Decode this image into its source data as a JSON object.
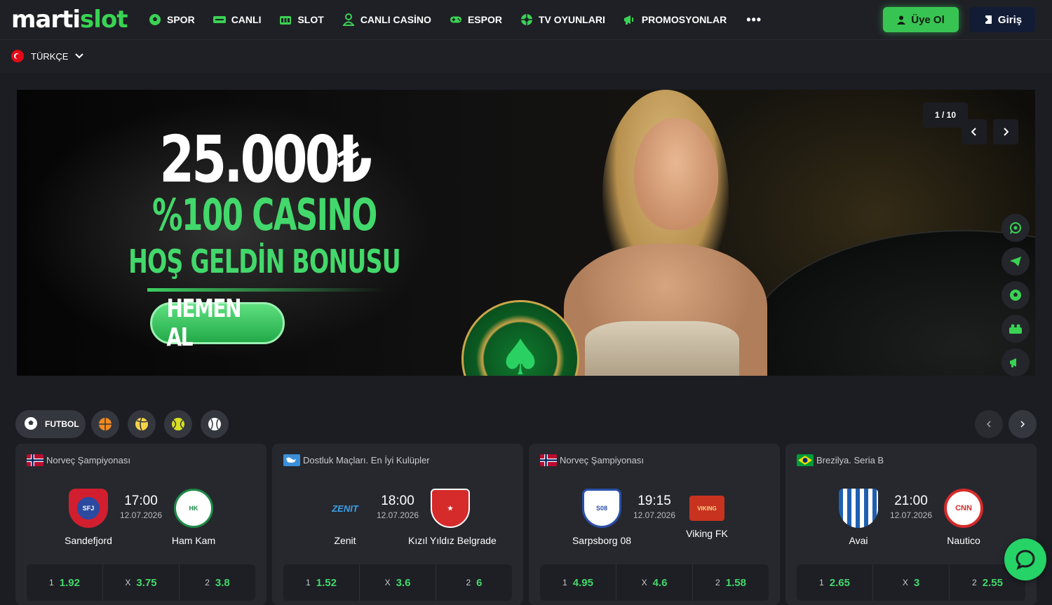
{
  "brand": {
    "logo_a": "marti",
    "logo_b": "slot",
    "accent": "#39d353"
  },
  "nav": {
    "items": [
      {
        "label": "SPOR",
        "icon": "soccer-ball-icon"
      },
      {
        "label": "CANLI",
        "icon": "live-icon"
      },
      {
        "label": "SLOT",
        "icon": "slot-icon"
      },
      {
        "label": "CANLI CASİNO",
        "icon": "dealer-icon"
      },
      {
        "label": "ESPOR",
        "icon": "gamepad-icon"
      },
      {
        "label": "TV OYUNLARI",
        "icon": "wheel-icon"
      },
      {
        "label": "PROMOSYONLAR",
        "icon": "megaphone-icon"
      }
    ],
    "more": "•••"
  },
  "auth": {
    "register": "Üye Ol",
    "login": "Giriş"
  },
  "language": {
    "label": "TÜRKÇE"
  },
  "banner": {
    "amount": "25.000₺",
    "line2": "%100 CASINO",
    "line3": "HOŞ GELDİN BONUSU",
    "cta": "HEMEN AL",
    "counter": "1 / 10"
  },
  "side_actions": [
    "whatsapp-icon",
    "telegram-icon",
    "soccer-icon",
    "casino-icon",
    "megaphone-icon"
  ],
  "sports_filter": {
    "active": "FUTBOL",
    "others": [
      "basketball-icon",
      "volleyball-icon",
      "tennis-icon",
      "baseball-icon"
    ]
  },
  "matches": [
    {
      "league": "Norveç Şampiyonası",
      "home": "Sandefjord",
      "away": "Ham Kam",
      "time": "17:00",
      "date": "12.07.2026",
      "odds": [
        {
          "label": "1",
          "value": "1.92"
        },
        {
          "label": "X",
          "value": "3.75"
        },
        {
          "label": "2",
          "value": "3.8"
        }
      ]
    },
    {
      "league": "Dostluk Maçları. En İyi Kulüpler",
      "home": "Zenit",
      "away": "Kızıl Yıldız Belgrade",
      "time": "18:00",
      "date": "12.07.2026",
      "odds": [
        {
          "label": "1",
          "value": "1.52"
        },
        {
          "label": "X",
          "value": "3.6"
        },
        {
          "label": "2",
          "value": "6"
        }
      ]
    },
    {
      "league": "Norveç Şampiyonası",
      "home": "Sarpsborg 08",
      "away": "Viking FK",
      "time": "19:15",
      "date": "12.07.2026",
      "odds": [
        {
          "label": "1",
          "value": "4.95"
        },
        {
          "label": "X",
          "value": "4.6"
        },
        {
          "label": "2",
          "value": "1.58"
        }
      ]
    },
    {
      "league": "Brezilya. Seria B",
      "home": "Avai",
      "away": "Nautico",
      "time": "21:00",
      "date": "12.07.2026",
      "odds": [
        {
          "label": "1",
          "value": "2.65"
        },
        {
          "label": "X",
          "value": "3"
        },
        {
          "label": "2",
          "value": "2.55"
        }
      ]
    }
  ]
}
